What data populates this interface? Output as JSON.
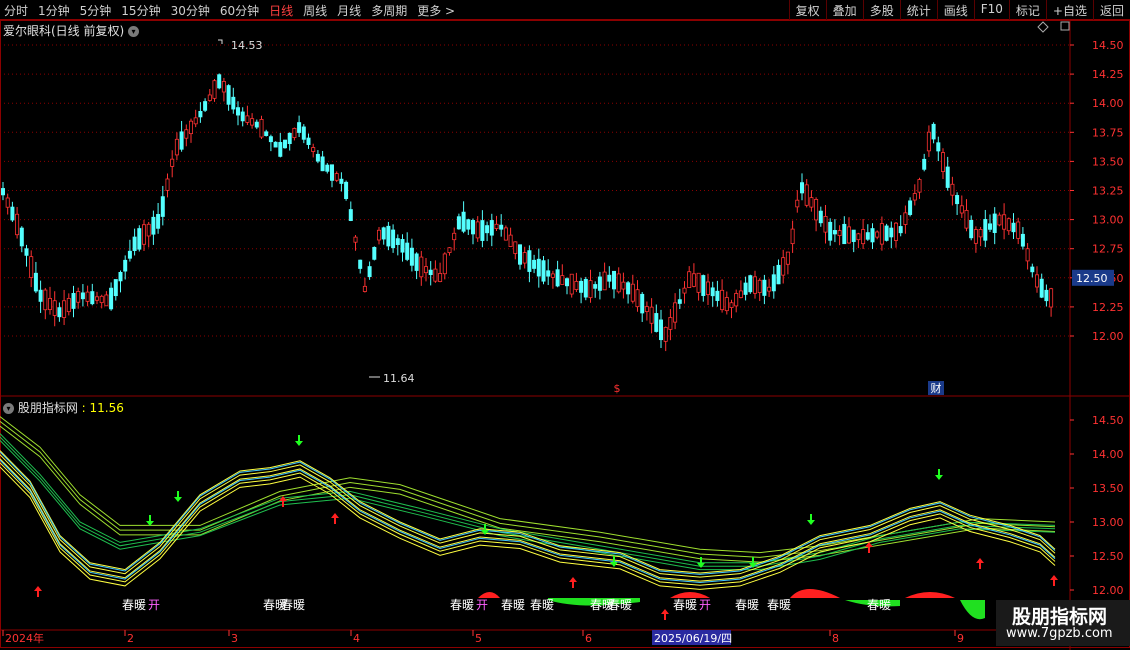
{
  "toolbar": {
    "periods": [
      "分时",
      "1分钟",
      "5分钟",
      "15分钟",
      "30分钟",
      "60分钟",
      "日线",
      "周线",
      "月线",
      "多周期",
      "更多 >"
    ],
    "active_period": "日线",
    "right_buttons": [
      "复权",
      "叠加",
      "多股",
      "统计",
      "画线",
      "F10",
      "标记",
      "+自选",
      "返回"
    ]
  },
  "main_panel": {
    "title": "爱尔眼科(日线 前复权)",
    "price_axis": [
      "14.50",
      "14.25",
      "14.00",
      "13.75",
      "13.50",
      "13.25",
      "13.00",
      "12.75",
      "12.50",
      "12.25",
      "12.00"
    ],
    "current_price": "12.50",
    "high_label": "14.53",
    "low_label": "11.64",
    "markers": [
      "$",
      "财"
    ]
  },
  "indicator_panel": {
    "name": "股朋指标网",
    "value": "11.56",
    "axis": [
      "14.50",
      "14.00",
      "13.50",
      "13.00",
      "12.50",
      "12.00"
    ],
    "text_labels": [
      "春暖",
      "开",
      "春暖",
      "春暖",
      "春暖",
      "开",
      "春暖",
      "春暖",
      "春暖",
      "春暖",
      "春暖",
      "开",
      "春暖",
      "春暖",
      "春暖"
    ]
  },
  "date_axis": {
    "labels": [
      "2024年",
      "2",
      "3",
      "4",
      "5",
      "6",
      "7",
      "8",
      "9"
    ],
    "highlight": "2025/06/19/四"
  },
  "watermark": {
    "title": "股朋指标网",
    "url": "www.7gpzb.com"
  },
  "colors": {
    "up": "#ff3232",
    "down": "#54ffff",
    "grid": "#8b0000",
    "highlight_bg": "#2a2aa0"
  }
}
